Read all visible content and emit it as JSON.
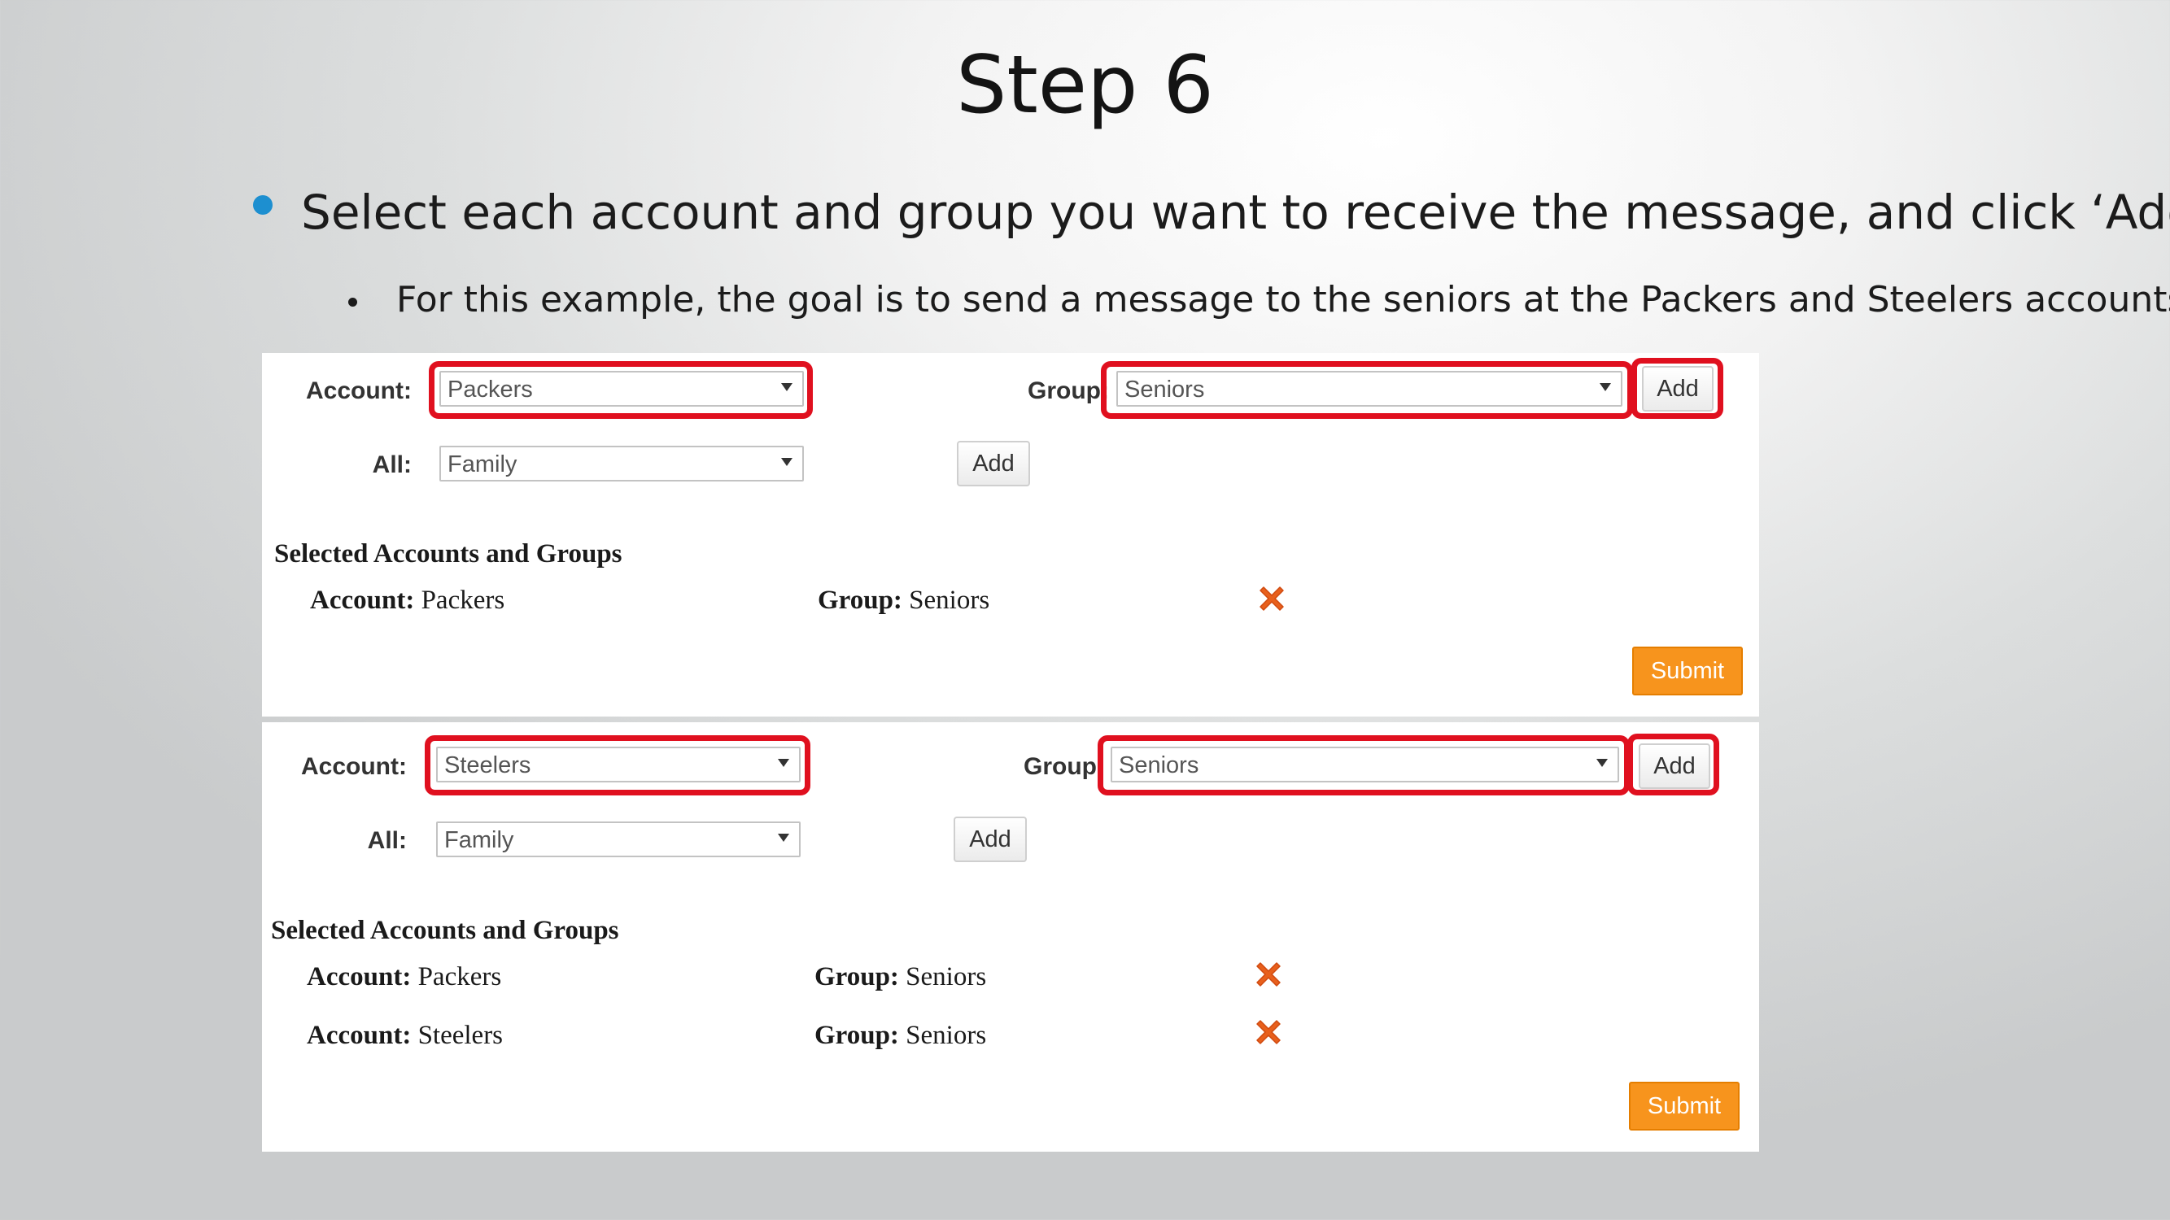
{
  "slide": {
    "title": "Step 6",
    "bullet_main": "Select each account and group you want to receive the message, and click ‘Add’",
    "bullet_sub": "For this example, the goal is to send a message to the seniors at the Packers and Steelers accounts"
  },
  "panel1": {
    "account_label": "Account:",
    "account_value": "Packers",
    "group_label": "Group:",
    "group_value": "Seniors",
    "add_label": "Add",
    "all_label": "All:",
    "all_value": "Family",
    "all_add_label": "Add",
    "section_title": "Selected Accounts and Groups",
    "rows": [
      {
        "account_key": "Account:",
        "account": "Packers",
        "group_key": "Group:",
        "group": "Seniors"
      }
    ],
    "submit_label": "Submit"
  },
  "panel2": {
    "account_label": "Account:",
    "account_value": "Steelers",
    "group_label": "Group:",
    "group_value": "Seniors",
    "add_label": "Add",
    "all_label": "All:",
    "all_value": "Family",
    "all_add_label": "Add",
    "section_title": "Selected Accounts and Groups",
    "rows": [
      {
        "account_key": "Account:",
        "account": "Packers",
        "group_key": "Group:",
        "group": "Seniors"
      },
      {
        "account_key": "Account:",
        "account": "Steelers",
        "group_key": "Group:",
        "group": "Seniors"
      }
    ],
    "submit_label": "Submit"
  },
  "colors": {
    "highlight": "#e0101f",
    "submit": "#f7941d",
    "remove_icon": "#e8601c",
    "bullet": "#1d8fd0"
  },
  "icons": {
    "remove": "close-x-icon",
    "dropdown": "dropdown-arrow-icon"
  }
}
